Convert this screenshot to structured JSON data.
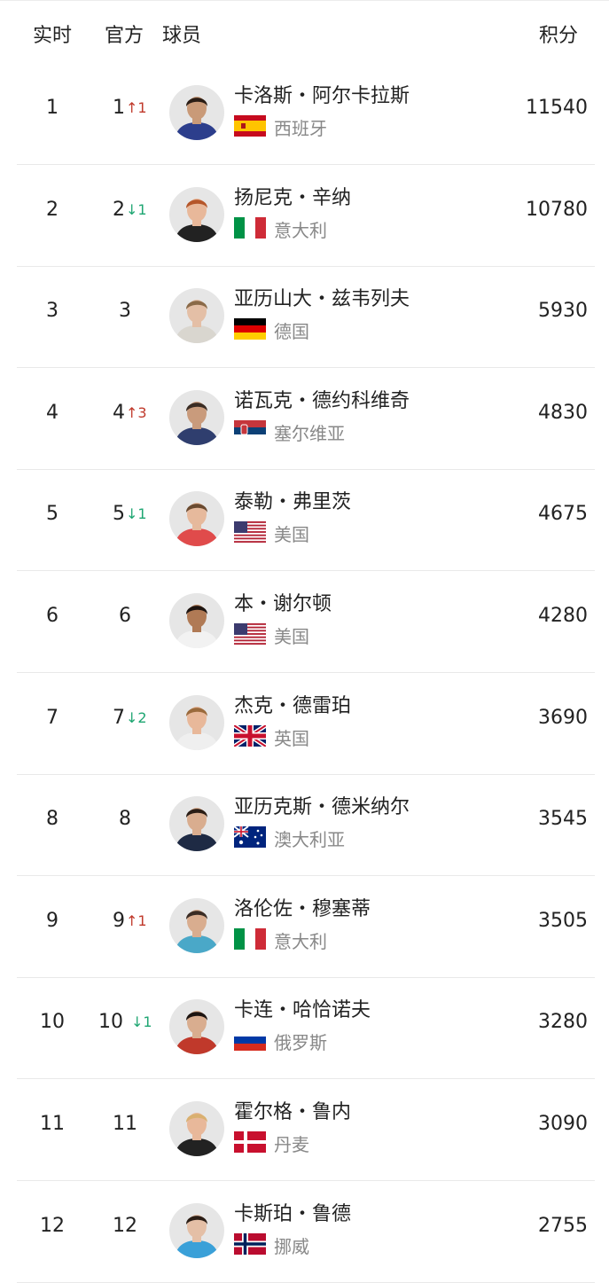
{
  "header": {
    "live_label": "实时",
    "official_label": "官方",
    "player_label": "球员",
    "points_label": "积分"
  },
  "players": [
    {
      "live_rank": "1",
      "official_rank": "1",
      "change": "↑1",
      "change_dir": "up",
      "name": "卡洛斯・阿尔卡拉斯",
      "country": "西班牙",
      "flag": "spain",
      "points": "11540",
      "shirt": "#2c3e8c",
      "skin": "#c99a78",
      "hair": "#2a1d15"
    },
    {
      "live_rank": "2",
      "official_rank": "2",
      "change": "↓1",
      "change_dir": "down",
      "name": "扬尼克・辛纳",
      "country": "意大利",
      "flag": "italy",
      "points": "10780",
      "shirt": "#222222",
      "skin": "#e8b89a",
      "hair": "#b5562a"
    },
    {
      "live_rank": "3",
      "official_rank": "3",
      "change": "",
      "change_dir": "none",
      "name": "亚历山大・兹韦列夫",
      "country": "德国",
      "flag": "germany",
      "points": "5930",
      "shirt": "#d9d6cf",
      "skin": "#e4bfa6",
      "hair": "#8a6a48"
    },
    {
      "live_rank": "4",
      "official_rank": "4",
      "change": "↑3",
      "change_dir": "up",
      "name": "诺瓦克・德约科维奇",
      "country": "塞尔维亚",
      "flag": "serbia",
      "points": "4830",
      "shirt": "#2f3e6e",
      "skin": "#c99b7c",
      "hair": "#3a2c24"
    },
    {
      "live_rank": "5",
      "official_rank": "5",
      "change": "↓1",
      "change_dir": "down",
      "name": "泰勒・弗里茨",
      "country": "美国",
      "flag": "usa",
      "points": "4675",
      "shirt": "#e04b4b",
      "skin": "#e6b99c",
      "hair": "#6a4a30"
    },
    {
      "live_rank": "6",
      "official_rank": "6",
      "change": "",
      "change_dir": "none",
      "name": "本・谢尔顿",
      "country": "美国",
      "flag": "usa",
      "points": "4280",
      "shirt": "#f2f2f2",
      "skin": "#b07a55",
      "hair": "#1d1410"
    },
    {
      "live_rank": "7",
      "official_rank": "7",
      "change": "↓2",
      "change_dir": "down",
      "name": "杰克・德雷珀",
      "country": "英国",
      "flag": "uk",
      "points": "3690",
      "shirt": "#efefef",
      "skin": "#e8b89a",
      "hair": "#9a6a3c"
    },
    {
      "live_rank": "8",
      "official_rank": "8",
      "change": "",
      "change_dir": "none",
      "name": "亚历克斯・德米纳尔",
      "country": "澳大利亚",
      "flag": "australia",
      "points": "3545",
      "shirt": "#1e2a44",
      "skin": "#d9ad8f",
      "hair": "#2a1d15"
    },
    {
      "live_rank": "9",
      "official_rank": "9",
      "change": "↑1",
      "change_dir": "up",
      "name": "洛伦佐・穆塞蒂",
      "country": "意大利",
      "flag": "italy",
      "points": "3505",
      "shirt": "#4aa8c8",
      "skin": "#d9ad8f",
      "hair": "#3a2c24"
    },
    {
      "live_rank": "10",
      "official_rank": "10",
      "change": "↓1",
      "change_dir": "down",
      "name": "卡连・哈恰诺夫",
      "country": "俄罗斯",
      "flag": "russia",
      "points": "3280",
      "shirt": "#c0392b",
      "skin": "#d9ad8f",
      "hair": "#1d1410"
    },
    {
      "live_rank": "11",
      "official_rank": "11",
      "change": "",
      "change_dir": "none",
      "name": "霍尔格・鲁内",
      "country": "丹麦",
      "flag": "denmark",
      "points": "3090",
      "shirt": "#222222",
      "skin": "#e8b89a",
      "hair": "#d9b070"
    },
    {
      "live_rank": "12",
      "official_rank": "12",
      "change": "",
      "change_dir": "none",
      "name": "卡斯珀・鲁德",
      "country": "挪威",
      "flag": "norway",
      "points": "2755",
      "shirt": "#3aa0d8",
      "skin": "#e4bfa6",
      "hair": "#2a1d15"
    }
  ]
}
